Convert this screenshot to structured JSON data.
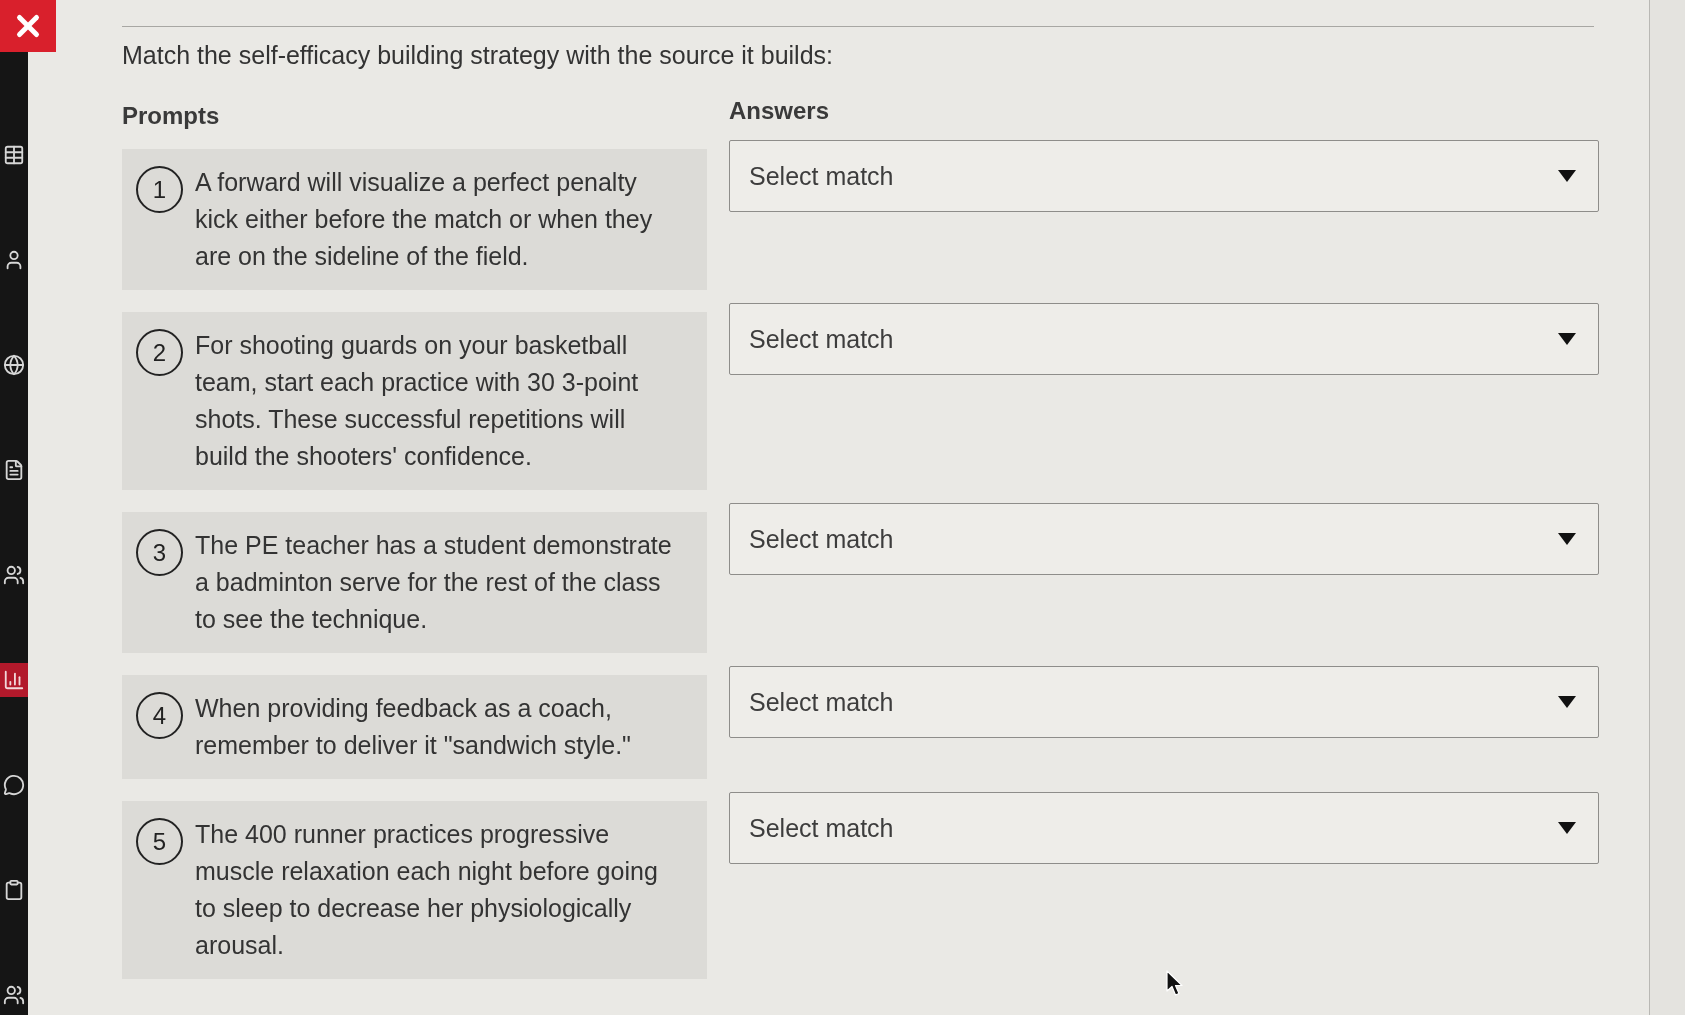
{
  "sidebar": {
    "items": [
      {
        "selected": false
      },
      {
        "selected": false
      },
      {
        "selected": false
      },
      {
        "selected": false
      },
      {
        "selected": false
      },
      {
        "selected": true
      },
      {
        "selected": false
      },
      {
        "selected": false
      },
      {
        "selected": false
      }
    ]
  },
  "question": {
    "instruction": "Match the self-efficacy building strategy with the source it builds:",
    "prompts_heading": "Prompts",
    "answers_heading": "Answers",
    "pairs": [
      {
        "number": "1",
        "prompt": "A forward will visualize a perfect penalty kick either before the match or when they are on the sideline of the field.",
        "answer": {
          "placeholder": "Select match"
        }
      },
      {
        "number": "2",
        "prompt": "For shooting guards on your basketball team, start each practice with 30 3-point shots. These successful repetitions will build the shooters' confidence.",
        "answer": {
          "placeholder": "Select match"
        }
      },
      {
        "number": "3",
        "prompt": "The PE teacher has a student demonstrate a badminton serve for the rest of the class to see the technique.",
        "answer": {
          "placeholder": "Select match"
        }
      },
      {
        "number": "4",
        "prompt": "When providing feedback as a coach, remember to deliver it \"sandwich style.\"",
        "answer": {
          "placeholder": "Select match"
        }
      },
      {
        "number": "5",
        "prompt": "The 400 runner practices progressive muscle relaxation each night before going to sleep to decrease her physiologically arousal.",
        "answer": {
          "placeholder": "Select match"
        }
      }
    ]
  }
}
